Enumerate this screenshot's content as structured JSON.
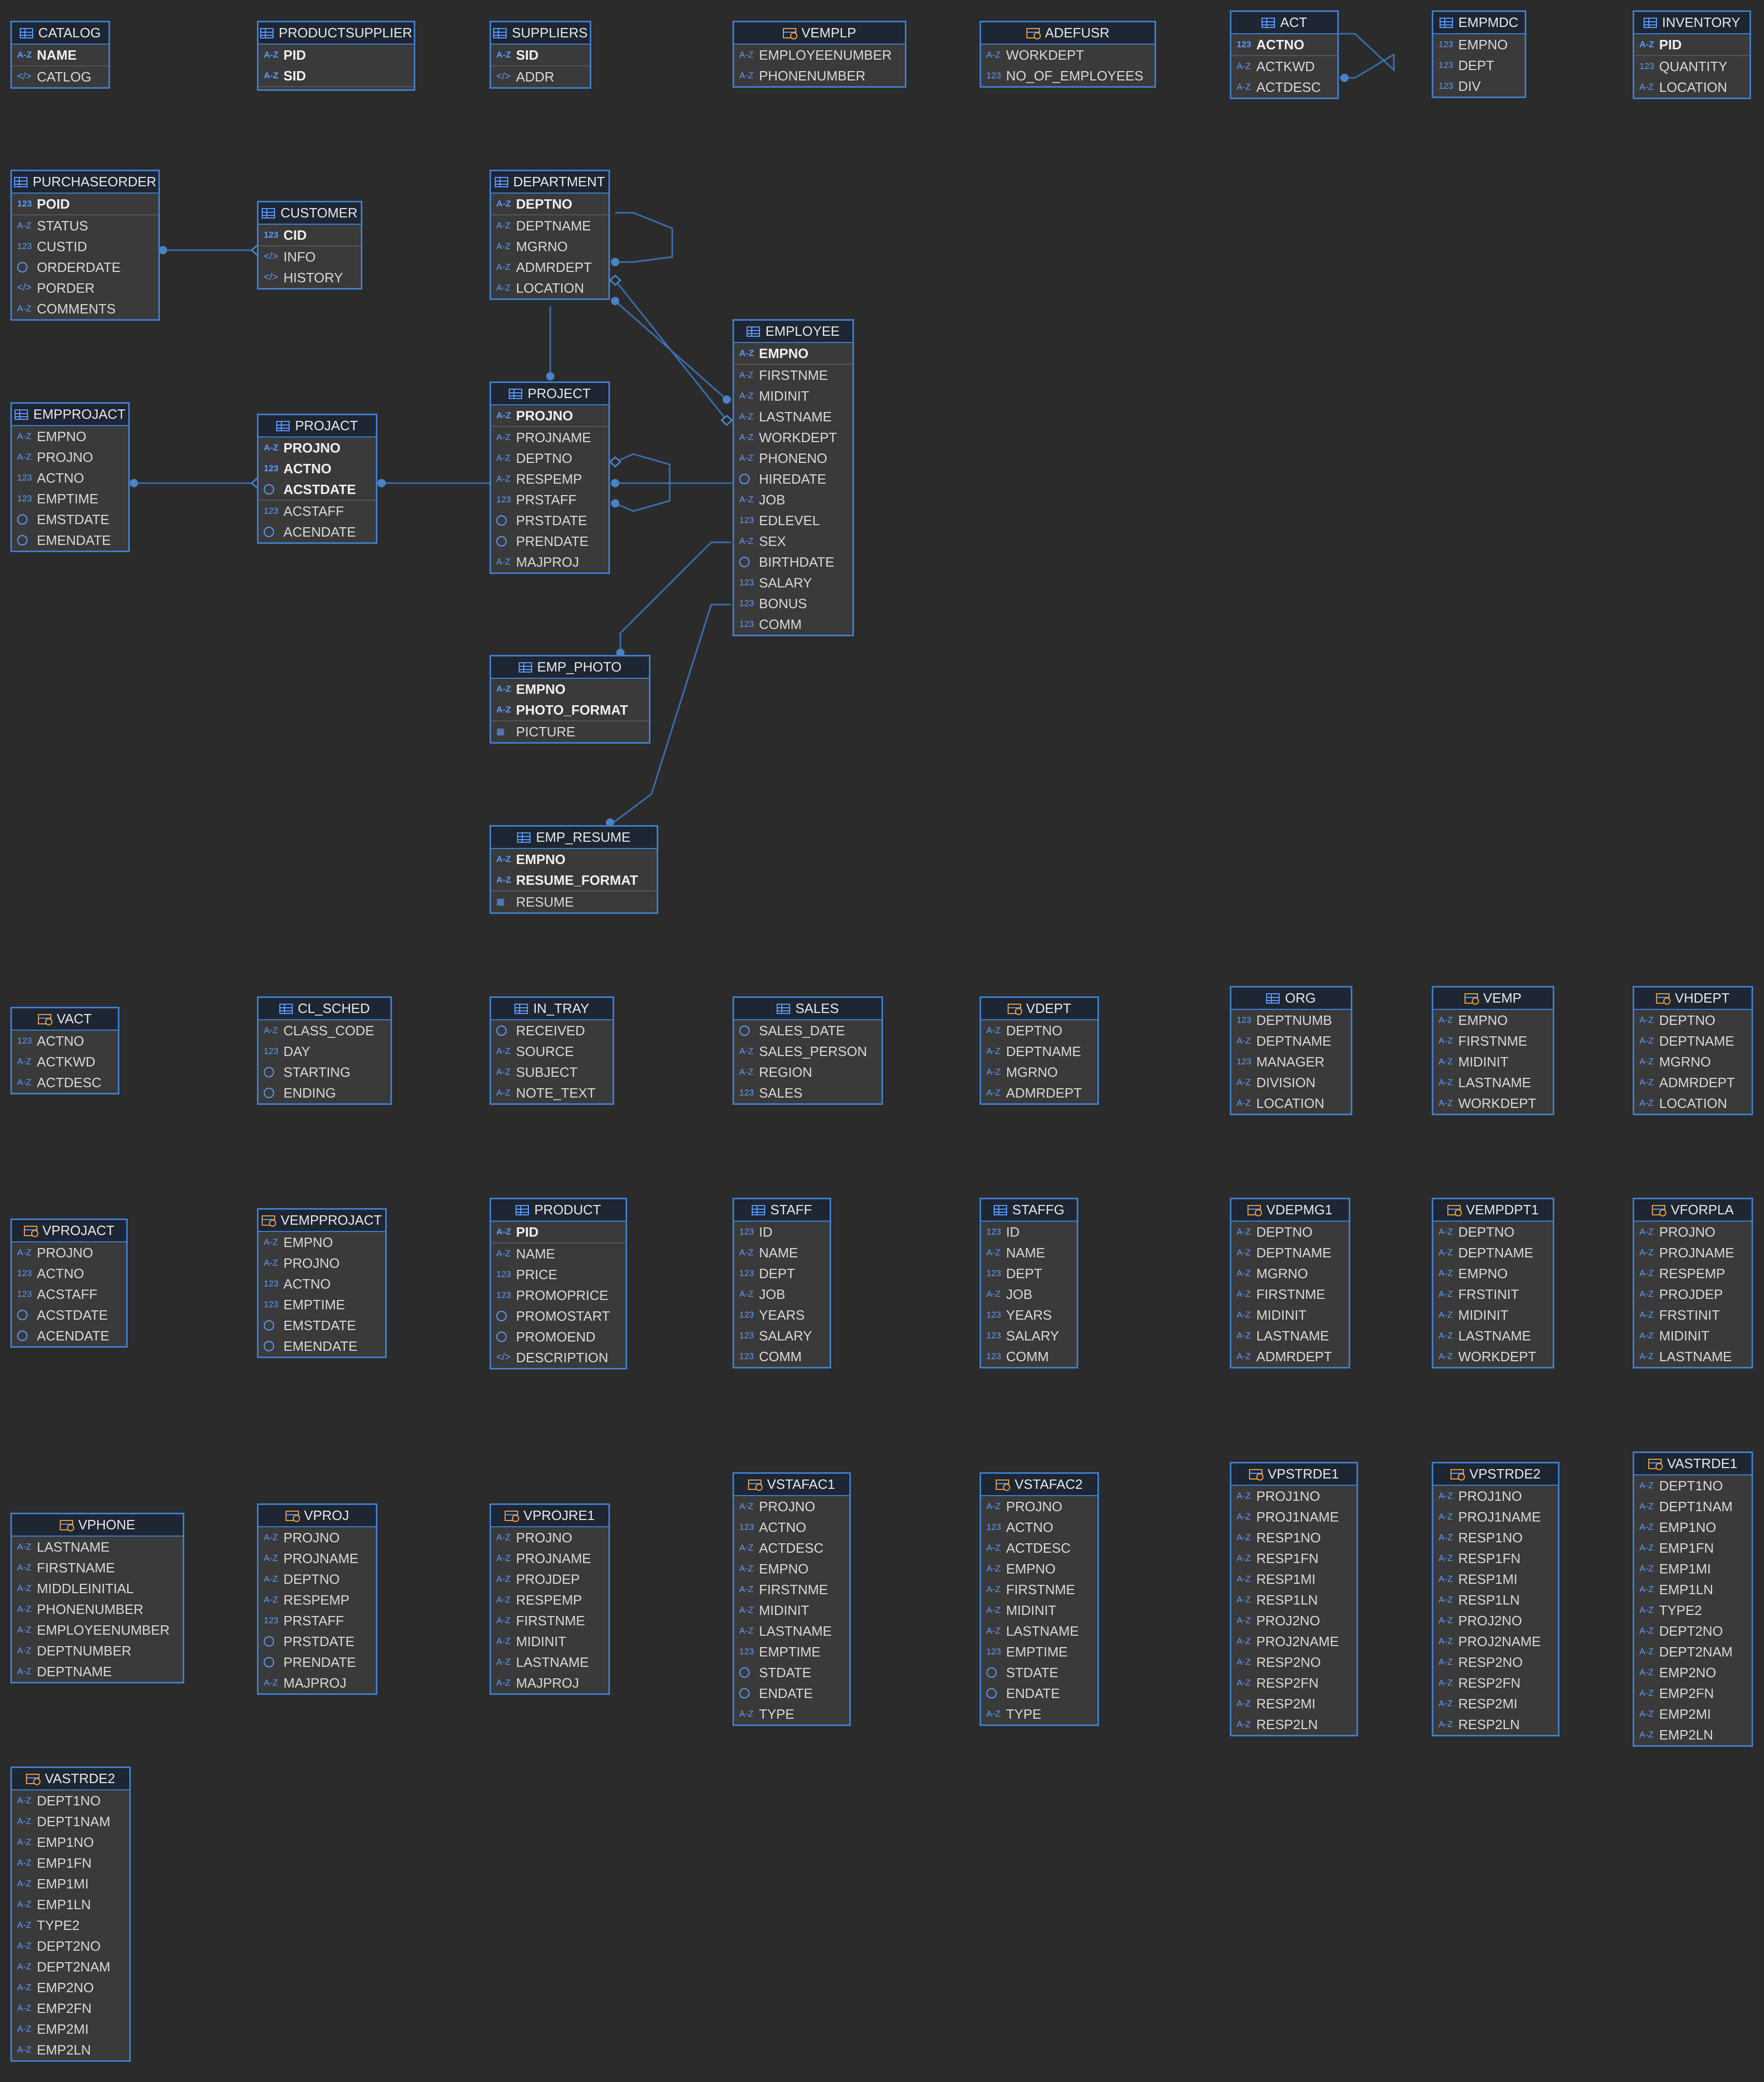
{
  "tables": [
    {
      "id": "CATALOG",
      "name": "CATALOG",
      "view": false,
      "pk": [
        [
          "az",
          "NAME"
        ]
      ],
      "cols": [
        [
          "xml",
          "CATLOG"
        ]
      ]
    },
    {
      "id": "PRODUCTSUPPLIER",
      "name": "PRODUCTSUPPLIER",
      "view": false,
      "pk": [
        [
          "az",
          "PID"
        ],
        [
          "az",
          "SID"
        ]
      ],
      "cols": []
    },
    {
      "id": "SUPPLIERS",
      "name": "SUPPLIERS",
      "view": false,
      "pk": [
        [
          "az",
          "SID"
        ]
      ],
      "cols": [
        [
          "xml",
          "ADDR"
        ]
      ]
    },
    {
      "id": "VEMPLP",
      "name": "VEMPLP",
      "view": true,
      "pk": [],
      "cols": [
        [
          "az",
          "EMPLOYEENUMBER"
        ],
        [
          "az",
          "PHONENUMBER"
        ]
      ]
    },
    {
      "id": "ADEFUSR",
      "name": "ADEFUSR",
      "view": true,
      "pk": [],
      "cols": [
        [
          "az",
          "WORKDEPT"
        ],
        [
          "num",
          "NO_OF_EMPLOYEES"
        ]
      ]
    },
    {
      "id": "ACT",
      "name": "ACT",
      "view": false,
      "pk": [
        [
          "num",
          "ACTNO"
        ]
      ],
      "cols": [
        [
          "az",
          "ACTKWD"
        ],
        [
          "az",
          "ACTDESC"
        ]
      ]
    },
    {
      "id": "EMPMDC",
      "name": "EMPMDC",
      "view": false,
      "pk": [],
      "cols": [
        [
          "num",
          "EMPNO"
        ],
        [
          "num",
          "DEPT"
        ],
        [
          "num",
          "DIV"
        ]
      ]
    },
    {
      "id": "INVENTORY",
      "name": "INVENTORY",
      "view": false,
      "pk": [
        [
          "az",
          "PID"
        ]
      ],
      "cols": [
        [
          "num",
          "QUANTITY"
        ],
        [
          "az",
          "LOCATION"
        ]
      ]
    },
    {
      "id": "PURCHASEORDER",
      "name": "PURCHASEORDER",
      "view": false,
      "pk": [
        [
          "num",
          "POID"
        ]
      ],
      "cols": [
        [
          "az",
          "STATUS"
        ],
        [
          "num",
          "CUSTID"
        ],
        [
          "date",
          "ORDERDATE"
        ],
        [
          "xml",
          "PORDER"
        ],
        [
          "az",
          "COMMENTS"
        ]
      ]
    },
    {
      "id": "CUSTOMER",
      "name": "CUSTOMER",
      "view": false,
      "pk": [
        [
          "num",
          "CID"
        ]
      ],
      "cols": [
        [
          "xml",
          "INFO"
        ],
        [
          "xml",
          "HISTORY"
        ]
      ]
    },
    {
      "id": "DEPARTMENT",
      "name": "DEPARTMENT",
      "view": false,
      "pk": [
        [
          "az",
          "DEPTNO"
        ]
      ],
      "cols": [
        [
          "az",
          "DEPTNAME"
        ],
        [
          "az",
          "MGRNO"
        ],
        [
          "az",
          "ADMRDEPT"
        ],
        [
          "az",
          "LOCATION"
        ]
      ]
    },
    {
      "id": "EMPLOYEE",
      "name": "EMPLOYEE",
      "view": false,
      "pk": [
        [
          "az",
          "EMPNO"
        ]
      ],
      "cols": [
        [
          "az",
          "FIRSTNME"
        ],
        [
          "az",
          "MIDINIT"
        ],
        [
          "az",
          "LASTNAME"
        ],
        [
          "az",
          "WORKDEPT"
        ],
        [
          "az",
          "PHONENO"
        ],
        [
          "date",
          "HIREDATE"
        ],
        [
          "az",
          "JOB"
        ],
        [
          "num",
          "EDLEVEL"
        ],
        [
          "az",
          "SEX"
        ],
        [
          "date",
          "BIRTHDATE"
        ],
        [
          "num",
          "SALARY"
        ],
        [
          "num",
          "BONUS"
        ],
        [
          "num",
          "COMM"
        ]
      ]
    },
    {
      "id": "EMPPROJACT",
      "name": "EMPPROJACT",
      "view": false,
      "pk": [],
      "cols": [
        [
          "az",
          "EMPNO"
        ],
        [
          "az",
          "PROJNO"
        ],
        [
          "num",
          "ACTNO"
        ],
        [
          "num",
          "EMPTIME"
        ],
        [
          "date",
          "EMSTDATE"
        ],
        [
          "date",
          "EMENDATE"
        ]
      ]
    },
    {
      "id": "PROJACT",
      "name": "PROJACT",
      "view": false,
      "pk": [
        [
          "az",
          "PROJNO"
        ],
        [
          "num",
          "ACTNO"
        ],
        [
          "date",
          "ACSTDATE"
        ]
      ],
      "cols": [
        [
          "num",
          "ACSTAFF"
        ],
        [
          "date",
          "ACENDATE"
        ]
      ]
    },
    {
      "id": "PROJECT",
      "name": "PROJECT",
      "view": false,
      "pk": [
        [
          "az",
          "PROJNO"
        ]
      ],
      "cols": [
        [
          "az",
          "PROJNAME"
        ],
        [
          "az",
          "DEPTNO"
        ],
        [
          "az",
          "RESPEMP"
        ],
        [
          "num",
          "PRSTAFF"
        ],
        [
          "date",
          "PRSTDATE"
        ],
        [
          "date",
          "PRENDATE"
        ],
        [
          "az",
          "MAJPROJ"
        ]
      ]
    },
    {
      "id": "EMP_PHOTO",
      "name": "EMP_PHOTO",
      "view": false,
      "pk": [
        [
          "az",
          "EMPNO"
        ],
        [
          "az",
          "PHOTO_FORMAT"
        ]
      ],
      "cols": [
        [
          "bin",
          "PICTURE"
        ]
      ]
    },
    {
      "id": "EMP_RESUME",
      "name": "EMP_RESUME",
      "view": false,
      "pk": [
        [
          "az",
          "EMPNO"
        ],
        [
          "az",
          "RESUME_FORMAT"
        ]
      ],
      "cols": [
        [
          "bin",
          "RESUME"
        ]
      ]
    },
    {
      "id": "VACT",
      "name": "VACT",
      "view": true,
      "pk": [],
      "cols": [
        [
          "num",
          "ACTNO"
        ],
        [
          "az",
          "ACTKWD"
        ],
        [
          "az",
          "ACTDESC"
        ]
      ]
    },
    {
      "id": "CL_SCHED",
      "name": "CL_SCHED",
      "view": false,
      "pk": [],
      "cols": [
        [
          "az",
          "CLASS_CODE"
        ],
        [
          "num",
          "DAY"
        ],
        [
          "date",
          "STARTING"
        ],
        [
          "date",
          "ENDING"
        ]
      ]
    },
    {
      "id": "IN_TRAY",
      "name": "IN_TRAY",
      "view": false,
      "pk": [],
      "cols": [
        [
          "date",
          "RECEIVED"
        ],
        [
          "az",
          "SOURCE"
        ],
        [
          "az",
          "SUBJECT"
        ],
        [
          "az",
          "NOTE_TEXT"
        ]
      ]
    },
    {
      "id": "SALES",
      "name": "SALES",
      "view": false,
      "pk": [],
      "cols": [
        [
          "date",
          "SALES_DATE"
        ],
        [
          "az",
          "SALES_PERSON"
        ],
        [
          "az",
          "REGION"
        ],
        [
          "num",
          "SALES"
        ]
      ]
    },
    {
      "id": "VDEPT",
      "name": "VDEPT",
      "view": true,
      "pk": [],
      "cols": [
        [
          "az",
          "DEPTNO"
        ],
        [
          "az",
          "DEPTNAME"
        ],
        [
          "az",
          "MGRNO"
        ],
        [
          "az",
          "ADMRDEPT"
        ]
      ]
    },
    {
      "id": "ORG",
      "name": "ORG",
      "view": false,
      "pk": [],
      "cols": [
        [
          "num",
          "DEPTNUMB"
        ],
        [
          "az",
          "DEPTNAME"
        ],
        [
          "num",
          "MANAGER"
        ],
        [
          "az",
          "DIVISION"
        ],
        [
          "az",
          "LOCATION"
        ]
      ]
    },
    {
      "id": "VEMP",
      "name": "VEMP",
      "view": true,
      "pk": [],
      "cols": [
        [
          "az",
          "EMPNO"
        ],
        [
          "az",
          "FIRSTNME"
        ],
        [
          "az",
          "MIDINIT"
        ],
        [
          "az",
          "LASTNAME"
        ],
        [
          "az",
          "WORKDEPT"
        ]
      ]
    },
    {
      "id": "VHDEPT",
      "name": "VHDEPT",
      "view": true,
      "pk": [],
      "cols": [
        [
          "az",
          "DEPTNO"
        ],
        [
          "az",
          "DEPTNAME"
        ],
        [
          "az",
          "MGRNO"
        ],
        [
          "az",
          "ADMRDEPT"
        ],
        [
          "az",
          "LOCATION"
        ]
      ]
    },
    {
      "id": "VPROJACT",
      "name": "VPROJACT",
      "view": true,
      "pk": [],
      "cols": [
        [
          "az",
          "PROJNO"
        ],
        [
          "num",
          "ACTNO"
        ],
        [
          "num",
          "ACSTAFF"
        ],
        [
          "date",
          "ACSTDATE"
        ],
        [
          "date",
          "ACENDATE"
        ]
      ]
    },
    {
      "id": "VEMPPROJACT",
      "name": "VEMPPROJACT",
      "view": true,
      "pk": [],
      "cols": [
        [
          "az",
          "EMPNO"
        ],
        [
          "az",
          "PROJNO"
        ],
        [
          "num",
          "ACTNO"
        ],
        [
          "num",
          "EMPTIME"
        ],
        [
          "date",
          "EMSTDATE"
        ],
        [
          "date",
          "EMENDATE"
        ]
      ]
    },
    {
      "id": "PRODUCT",
      "name": "PRODUCT",
      "view": false,
      "pk": [
        [
          "az",
          "PID"
        ]
      ],
      "cols": [
        [
          "az",
          "NAME"
        ],
        [
          "num",
          "PRICE"
        ],
        [
          "num",
          "PROMOPRICE"
        ],
        [
          "date",
          "PROMOSTART"
        ],
        [
          "date",
          "PROMOEND"
        ],
        [
          "xml",
          "DESCRIPTION"
        ]
      ]
    },
    {
      "id": "STAFF",
      "name": "STAFF",
      "view": false,
      "pk": [],
      "cols": [
        [
          "num",
          "ID"
        ],
        [
          "az",
          "NAME"
        ],
        [
          "num",
          "DEPT"
        ],
        [
          "az",
          "JOB"
        ],
        [
          "num",
          "YEARS"
        ],
        [
          "num",
          "SALARY"
        ],
        [
          "num",
          "COMM"
        ]
      ]
    },
    {
      "id": "STAFFG",
      "name": "STAFFG",
      "view": false,
      "pk": [],
      "cols": [
        [
          "num",
          "ID"
        ],
        [
          "az",
          "NAME"
        ],
        [
          "num",
          "DEPT"
        ],
        [
          "az",
          "JOB"
        ],
        [
          "num",
          "YEARS"
        ],
        [
          "num",
          "SALARY"
        ],
        [
          "num",
          "COMM"
        ]
      ]
    },
    {
      "id": "VDEPMG1",
      "name": "VDEPMG1",
      "view": true,
      "pk": [],
      "cols": [
        [
          "az",
          "DEPTNO"
        ],
        [
          "az",
          "DEPTNAME"
        ],
        [
          "az",
          "MGRNO"
        ],
        [
          "az",
          "FIRSTNME"
        ],
        [
          "az",
          "MIDINIT"
        ],
        [
          "az",
          "LASTNAME"
        ],
        [
          "az",
          "ADMRDEPT"
        ]
      ]
    },
    {
      "id": "VEMPDPT1",
      "name": "VEMPDPT1",
      "view": true,
      "pk": [],
      "cols": [
        [
          "az",
          "DEPTNO"
        ],
        [
          "az",
          "DEPTNAME"
        ],
        [
          "az",
          "EMPNO"
        ],
        [
          "az",
          "FRSTINIT"
        ],
        [
          "az",
          "MIDINIT"
        ],
        [
          "az",
          "LASTNAME"
        ],
        [
          "az",
          "WORKDEPT"
        ]
      ]
    },
    {
      "id": "VFORPLA",
      "name": "VFORPLA",
      "view": true,
      "pk": [],
      "cols": [
        [
          "az",
          "PROJNO"
        ],
        [
          "az",
          "PROJNAME"
        ],
        [
          "az",
          "RESPEMP"
        ],
        [
          "az",
          "PROJDEP"
        ],
        [
          "az",
          "FRSTINIT"
        ],
        [
          "az",
          "MIDINIT"
        ],
        [
          "az",
          "LASTNAME"
        ]
      ]
    },
    {
      "id": "VPHONE",
      "name": "VPHONE",
      "view": true,
      "pk": [],
      "cols": [
        [
          "az",
          "LASTNAME"
        ],
        [
          "az",
          "FIRSTNAME"
        ],
        [
          "az",
          "MIDDLEINITIAL"
        ],
        [
          "az",
          "PHONENUMBER"
        ],
        [
          "az",
          "EMPLOYEENUMBER"
        ],
        [
          "az",
          "DEPTNUMBER"
        ],
        [
          "az",
          "DEPTNAME"
        ]
      ]
    },
    {
      "id": "VPROJ",
      "name": "VPROJ",
      "view": true,
      "pk": [],
      "cols": [
        [
          "az",
          "PROJNO"
        ],
        [
          "az",
          "PROJNAME"
        ],
        [
          "az",
          "DEPTNO"
        ],
        [
          "az",
          "RESPEMP"
        ],
        [
          "num",
          "PRSTAFF"
        ],
        [
          "date",
          "PRSTDATE"
        ],
        [
          "date",
          "PRENDATE"
        ],
        [
          "az",
          "MAJPROJ"
        ]
      ]
    },
    {
      "id": "VPROJRE1",
      "name": "VPROJRE1",
      "view": true,
      "pk": [],
      "cols": [
        [
          "az",
          "PROJNO"
        ],
        [
          "az",
          "PROJNAME"
        ],
        [
          "az",
          "PROJDEP"
        ],
        [
          "az",
          "RESPEMP"
        ],
        [
          "az",
          "FIRSTNME"
        ],
        [
          "az",
          "MIDINIT"
        ],
        [
          "az",
          "LASTNAME"
        ],
        [
          "az",
          "MAJPROJ"
        ]
      ]
    },
    {
      "id": "VSTAFAC1",
      "name": "VSTAFAC1",
      "view": true,
      "pk": [],
      "cols": [
        [
          "az",
          "PROJNO"
        ],
        [
          "num",
          "ACTNO"
        ],
        [
          "az",
          "ACTDESC"
        ],
        [
          "az",
          "EMPNO"
        ],
        [
          "az",
          "FIRSTNME"
        ],
        [
          "az",
          "MIDINIT"
        ],
        [
          "az",
          "LASTNAME"
        ],
        [
          "num",
          "EMPTIME"
        ],
        [
          "date",
          "STDATE"
        ],
        [
          "date",
          "ENDATE"
        ],
        [
          "az",
          "TYPE"
        ]
      ]
    },
    {
      "id": "VSTAFAC2",
      "name": "VSTAFAC2",
      "view": true,
      "pk": [],
      "cols": [
        [
          "az",
          "PROJNO"
        ],
        [
          "num",
          "ACTNO"
        ],
        [
          "az",
          "ACTDESC"
        ],
        [
          "az",
          "EMPNO"
        ],
        [
          "az",
          "FIRSTNME"
        ],
        [
          "az",
          "MIDINIT"
        ],
        [
          "az",
          "LASTNAME"
        ],
        [
          "num",
          "EMPTIME"
        ],
        [
          "date",
          "STDATE"
        ],
        [
          "date",
          "ENDATE"
        ],
        [
          "az",
          "TYPE"
        ]
      ]
    },
    {
      "id": "VPSTRDE1",
      "name": "VPSTRDE1",
      "view": true,
      "pk": [],
      "cols": [
        [
          "az",
          "PROJ1NO"
        ],
        [
          "az",
          "PROJ1NAME"
        ],
        [
          "az",
          "RESP1NO"
        ],
        [
          "az",
          "RESP1FN"
        ],
        [
          "az",
          "RESP1MI"
        ],
        [
          "az",
          "RESP1LN"
        ],
        [
          "az",
          "PROJ2NO"
        ],
        [
          "az",
          "PROJ2NAME"
        ],
        [
          "az",
          "RESP2NO"
        ],
        [
          "az",
          "RESP2FN"
        ],
        [
          "az",
          "RESP2MI"
        ],
        [
          "az",
          "RESP2LN"
        ]
      ]
    },
    {
      "id": "VPSTRDE2",
      "name": "VPSTRDE2",
      "view": true,
      "pk": [],
      "cols": [
        [
          "az",
          "PROJ1NO"
        ],
        [
          "az",
          "PROJ1NAME"
        ],
        [
          "az",
          "RESP1NO"
        ],
        [
          "az",
          "RESP1FN"
        ],
        [
          "az",
          "RESP1MI"
        ],
        [
          "az",
          "RESP1LN"
        ],
        [
          "az",
          "PROJ2NO"
        ],
        [
          "az",
          "PROJ2NAME"
        ],
        [
          "az",
          "RESP2NO"
        ],
        [
          "az",
          "RESP2FN"
        ],
        [
          "az",
          "RESP2MI"
        ],
        [
          "az",
          "RESP2LN"
        ]
      ]
    },
    {
      "id": "VASTRDE1",
      "name": "VASTRDE1",
      "view": true,
      "pk": [],
      "cols": [
        [
          "az",
          "DEPT1NO"
        ],
        [
          "az",
          "DEPT1NAM"
        ],
        [
          "az",
          "EMP1NO"
        ],
        [
          "az",
          "EMP1FN"
        ],
        [
          "az",
          "EMP1MI"
        ],
        [
          "az",
          "EMP1LN"
        ],
        [
          "az",
          "TYPE2"
        ],
        [
          "az",
          "DEPT2NO"
        ],
        [
          "az",
          "DEPT2NAM"
        ],
        [
          "az",
          "EMP2NO"
        ],
        [
          "az",
          "EMP2FN"
        ],
        [
          "az",
          "EMP2MI"
        ],
        [
          "az",
          "EMP2LN"
        ]
      ]
    },
    {
      "id": "VASTRDE2",
      "name": "VASTRDE2",
      "view": true,
      "pk": [],
      "cols": [
        [
          "az",
          "DEPT1NO"
        ],
        [
          "az",
          "DEPT1NAM"
        ],
        [
          "az",
          "EMP1NO"
        ],
        [
          "az",
          "EMP1FN"
        ],
        [
          "az",
          "EMP1MI"
        ],
        [
          "az",
          "EMP1LN"
        ],
        [
          "az",
          "TYPE2"
        ],
        [
          "az",
          "DEPT2NO"
        ],
        [
          "az",
          "DEPT2NAM"
        ],
        [
          "az",
          "EMP2NO"
        ],
        [
          "az",
          "EMP2FN"
        ],
        [
          "az",
          "EMP2MI"
        ],
        [
          "az",
          "EMP2LN"
        ]
      ]
    }
  ],
  "type_labels": {
    "az": "A-Z",
    "num": "123",
    "xml": "</>",
    "bin": "▦"
  },
  "colors": {
    "background": "#2b2b2b",
    "table_border": "#3f7fd0",
    "header_bg": "#1e2633",
    "link": "#3f7fd0"
  }
}
